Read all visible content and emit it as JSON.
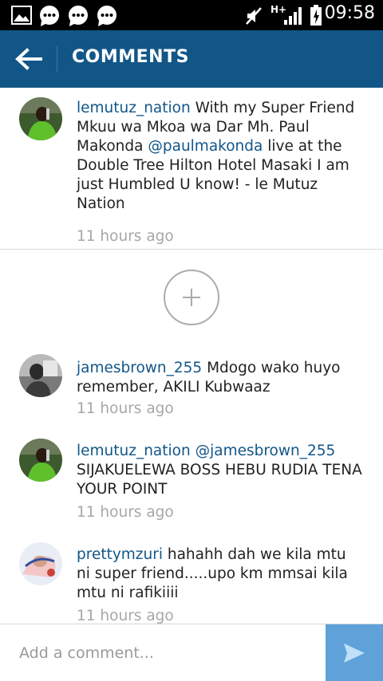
{
  "status_bar": {
    "time": "09:58",
    "icons": [
      "gallery-icon",
      "chat-bubble-icon",
      "chat-bubble-icon",
      "chat-bubble-icon",
      "mute-icon",
      "signal-icon",
      "battery-icon"
    ],
    "network": "H+"
  },
  "header": {
    "title": "COMMENTS",
    "back_icon": "arrow-left-icon"
  },
  "caption": {
    "user": "lemutuz_nation",
    "text_before": " With my Super Friend Mkuu wa Mkoa wa Dar Mh. Paul Makonda ",
    "mention": "@paulmakonda",
    "text_after": " live at the Double Tree Hilton Hotel Masaki I am just Humbled U know! - le Mutuz Nation",
    "time": "11 hours ago"
  },
  "load_more_icon": "plus-circle-icon",
  "comments": [
    {
      "user": "jamesbrown_255",
      "text": " Mdogo wako huyo remember, AKILI Kubwaaz",
      "time": "11 hours ago"
    },
    {
      "user": "lemutuz_nation",
      "mention": " @jamesbrown_255",
      "text": " SIJAKUELEWA BOSS HEBU RUDIA TENA YOUR POINT",
      "time": "11 hours ago"
    },
    {
      "user": "prettymzuri",
      "text": " hahahh dah we kila mtu ni super friend.....upo km mmsai kila mtu ni rafikiiii",
      "time": "11 hours ago"
    }
  ],
  "input": {
    "placeholder": "Add a comment...",
    "value": ""
  },
  "colors": {
    "header": "#125688",
    "link": "#125688",
    "timestamp": "#a5a7aa",
    "send_button": "#5fa2d9"
  }
}
